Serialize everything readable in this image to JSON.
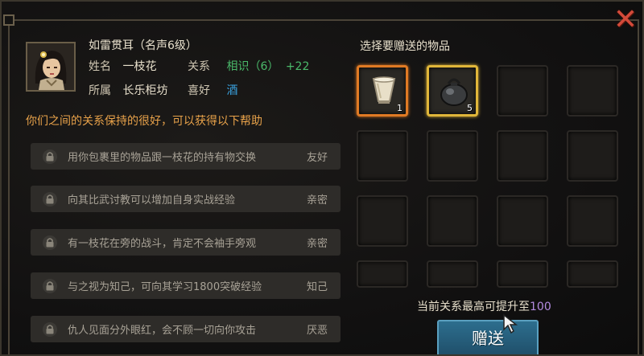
{
  "colors": {
    "accent_orange": "#e8a24a",
    "relation_green": "#4ab96a",
    "hobby_cyan": "#3aa3e0",
    "max_purple": "#b48be0",
    "button_blue": "#2d6e8e"
  },
  "header": {
    "name_title": "如雷贯耳（名声6级）",
    "name_label": "姓名",
    "name_value": "一枝花",
    "relation_label": "关系",
    "relation_value": "相识（6）",
    "relation_delta": "+22",
    "faction_label": "所属",
    "faction_value": "长乐柜坊",
    "hobby_label": "喜好",
    "hobby_value": "酒"
  },
  "help_title": "你们之间的关系保持的很好，可以获得以下帮助",
  "benefits": [
    {
      "text": "用你包裹里的物品跟一枝花的持有物交换",
      "relation": "友好"
    },
    {
      "text": "向其比武讨教可以增加自身实战经验",
      "relation": "亲密"
    },
    {
      "text": "有一枝花在旁的战斗，肯定不会袖手旁观",
      "relation": "亲密"
    },
    {
      "text": "与之视为知己，可向其学习1800突破经验",
      "relation": "知己"
    },
    {
      "text": "仇人见面分外眼红，会不顾一切向你攻击",
      "relation": "厌恶"
    }
  ],
  "gift": {
    "title": "选择要赠送的物品",
    "items": [
      {
        "icon": "cup-icon",
        "qty": "1"
      },
      {
        "icon": "pot-icon",
        "qty": "5"
      }
    ],
    "max_label": "当前关系最高可提升至",
    "max_value": "100",
    "button_label": "赠送"
  }
}
